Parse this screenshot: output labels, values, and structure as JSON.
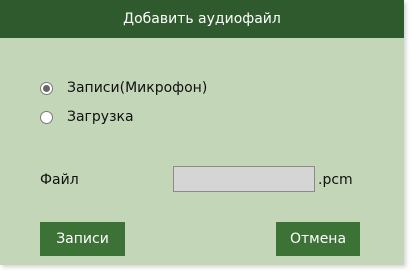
{
  "dialog": {
    "title": "Добавить аудиофайл",
    "options": [
      {
        "label": "Записи(Микрофон)",
        "selected": true
      },
      {
        "label": "Загрузка",
        "selected": false
      }
    ],
    "file": {
      "label": "Файл",
      "value": "",
      "extension": ".pcm"
    },
    "buttons": {
      "record": "Записи",
      "cancel": "Отмена"
    }
  },
  "colors": {
    "titlebar": "#2f5a2e",
    "background": "#c3d6b8",
    "button": "#3d7237"
  }
}
